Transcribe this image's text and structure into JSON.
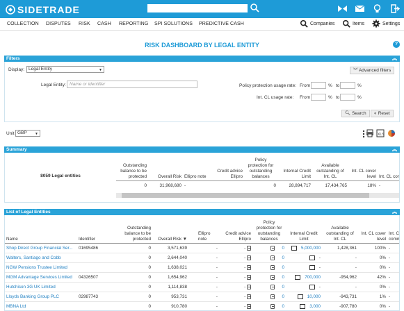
{
  "app": {
    "logo": "SIDETRADE"
  },
  "nav": {
    "items": [
      "COLLECTION",
      "DISPUTES",
      "RISK",
      "CASH",
      "REPORTING",
      "SPI SOLUTIONS",
      "PREDICTIVE CASH"
    ],
    "companies": "Companies",
    "items_label": "Items",
    "settings": "Settings"
  },
  "page": {
    "title": "RISK DASHBOARD BY LEGAL ENTITY"
  },
  "filters": {
    "title": "Filters",
    "display_label": "Display:",
    "display_value": "Legal Entity",
    "advanced": "Advanced filters",
    "legal_entity_label": "Legal Entity:",
    "legal_entity_placeholder": "Name or identifier",
    "policy_label": "Policy protection usage rate:",
    "intcl_label": "Int. CL usage rate:",
    "from": "From",
    "to": "to",
    "pct": "%",
    "search": "Search",
    "reset": "Reset"
  },
  "unit": {
    "label": "Unit",
    "value": "GBP"
  },
  "summary": {
    "title": "Summary",
    "entities": "8059 Legal entities",
    "headers": [
      "Outstanding balance to be protected",
      "Overall Risk",
      "Ellipro note",
      "Credit advice Ellipro",
      "Policy protection for outstanding balances",
      "Internal Credit Limit",
      "Available outstanding of Int. CL",
      "Int. CL cover level",
      "Int. CL comm"
    ],
    "values": [
      "0",
      "31,968,680",
      "-",
      "",
      "0",
      "28,894,717",
      "17,434,765",
      "18%",
      "-"
    ]
  },
  "list": {
    "title": "List of Legal Entities",
    "headers": [
      "Name",
      "Identifier",
      "Outstanding balance to be protected",
      "Overall Risk",
      "Ellipro note",
      "Credit advice Ellipro",
      "Policy protection for outstanding balances",
      "Internal Credit Limit",
      "Available outstanding of Int. CL",
      "Int. CL cover level",
      "Int. Cl comm"
    ],
    "rows": [
      {
        "name": "Shop Direct Group Financial Ser...",
        "id": "01695486",
        "obp": "0",
        "risk": "3,571,639",
        "note": "-",
        "ppo": "0",
        "icl": "5,000,000",
        "avail": "1,428,361",
        "cover": "100%",
        "comm": "-"
      },
      {
        "name": "Walters, Santiago and Cobb",
        "id": "",
        "obp": "0",
        "risk": "2,644,040",
        "note": "-",
        "ppo": "0",
        "icl": "-",
        "avail": "-",
        "cover": "0%",
        "comm": "-"
      },
      {
        "name": "NGW Pensions Trustee Limited",
        "id": "",
        "obp": "0",
        "risk": "1,638,021",
        "note": "-",
        "ppo": "0",
        "icl": "-",
        "avail": "-",
        "cover": "0%",
        "comm": "-"
      },
      {
        "name": "MGM Advantage Services Limited",
        "id": "04326507",
        "obp": "0",
        "risk": "1,654,962",
        "note": "-",
        "ppo": "0",
        "icl": "700,000",
        "avail": "-954,962",
        "cover": "42%",
        "comm": "-"
      },
      {
        "name": "Hutchison 3G UK Limited",
        "id": "",
        "obp": "0",
        "risk": "1,114,838",
        "note": "-",
        "ppo": "0",
        "icl": "-",
        "avail": "-",
        "cover": "0%",
        "comm": "-"
      },
      {
        "name": "Lloyds Banking Group PLC",
        "id": "02987743",
        "obp": "0",
        "risk": "953,731",
        "note": "-",
        "ppo": "0",
        "icl": "10,000",
        "avail": "-943,731",
        "cover": "1%",
        "comm": "-"
      },
      {
        "name": "MBNA Ltd",
        "id": "",
        "obp": "0",
        "risk": "910,780",
        "note": "-",
        "ppo": "0",
        "icl": "3,000",
        "avail": "-907,780",
        "cover": "0%",
        "comm": "-"
      }
    ]
  }
}
